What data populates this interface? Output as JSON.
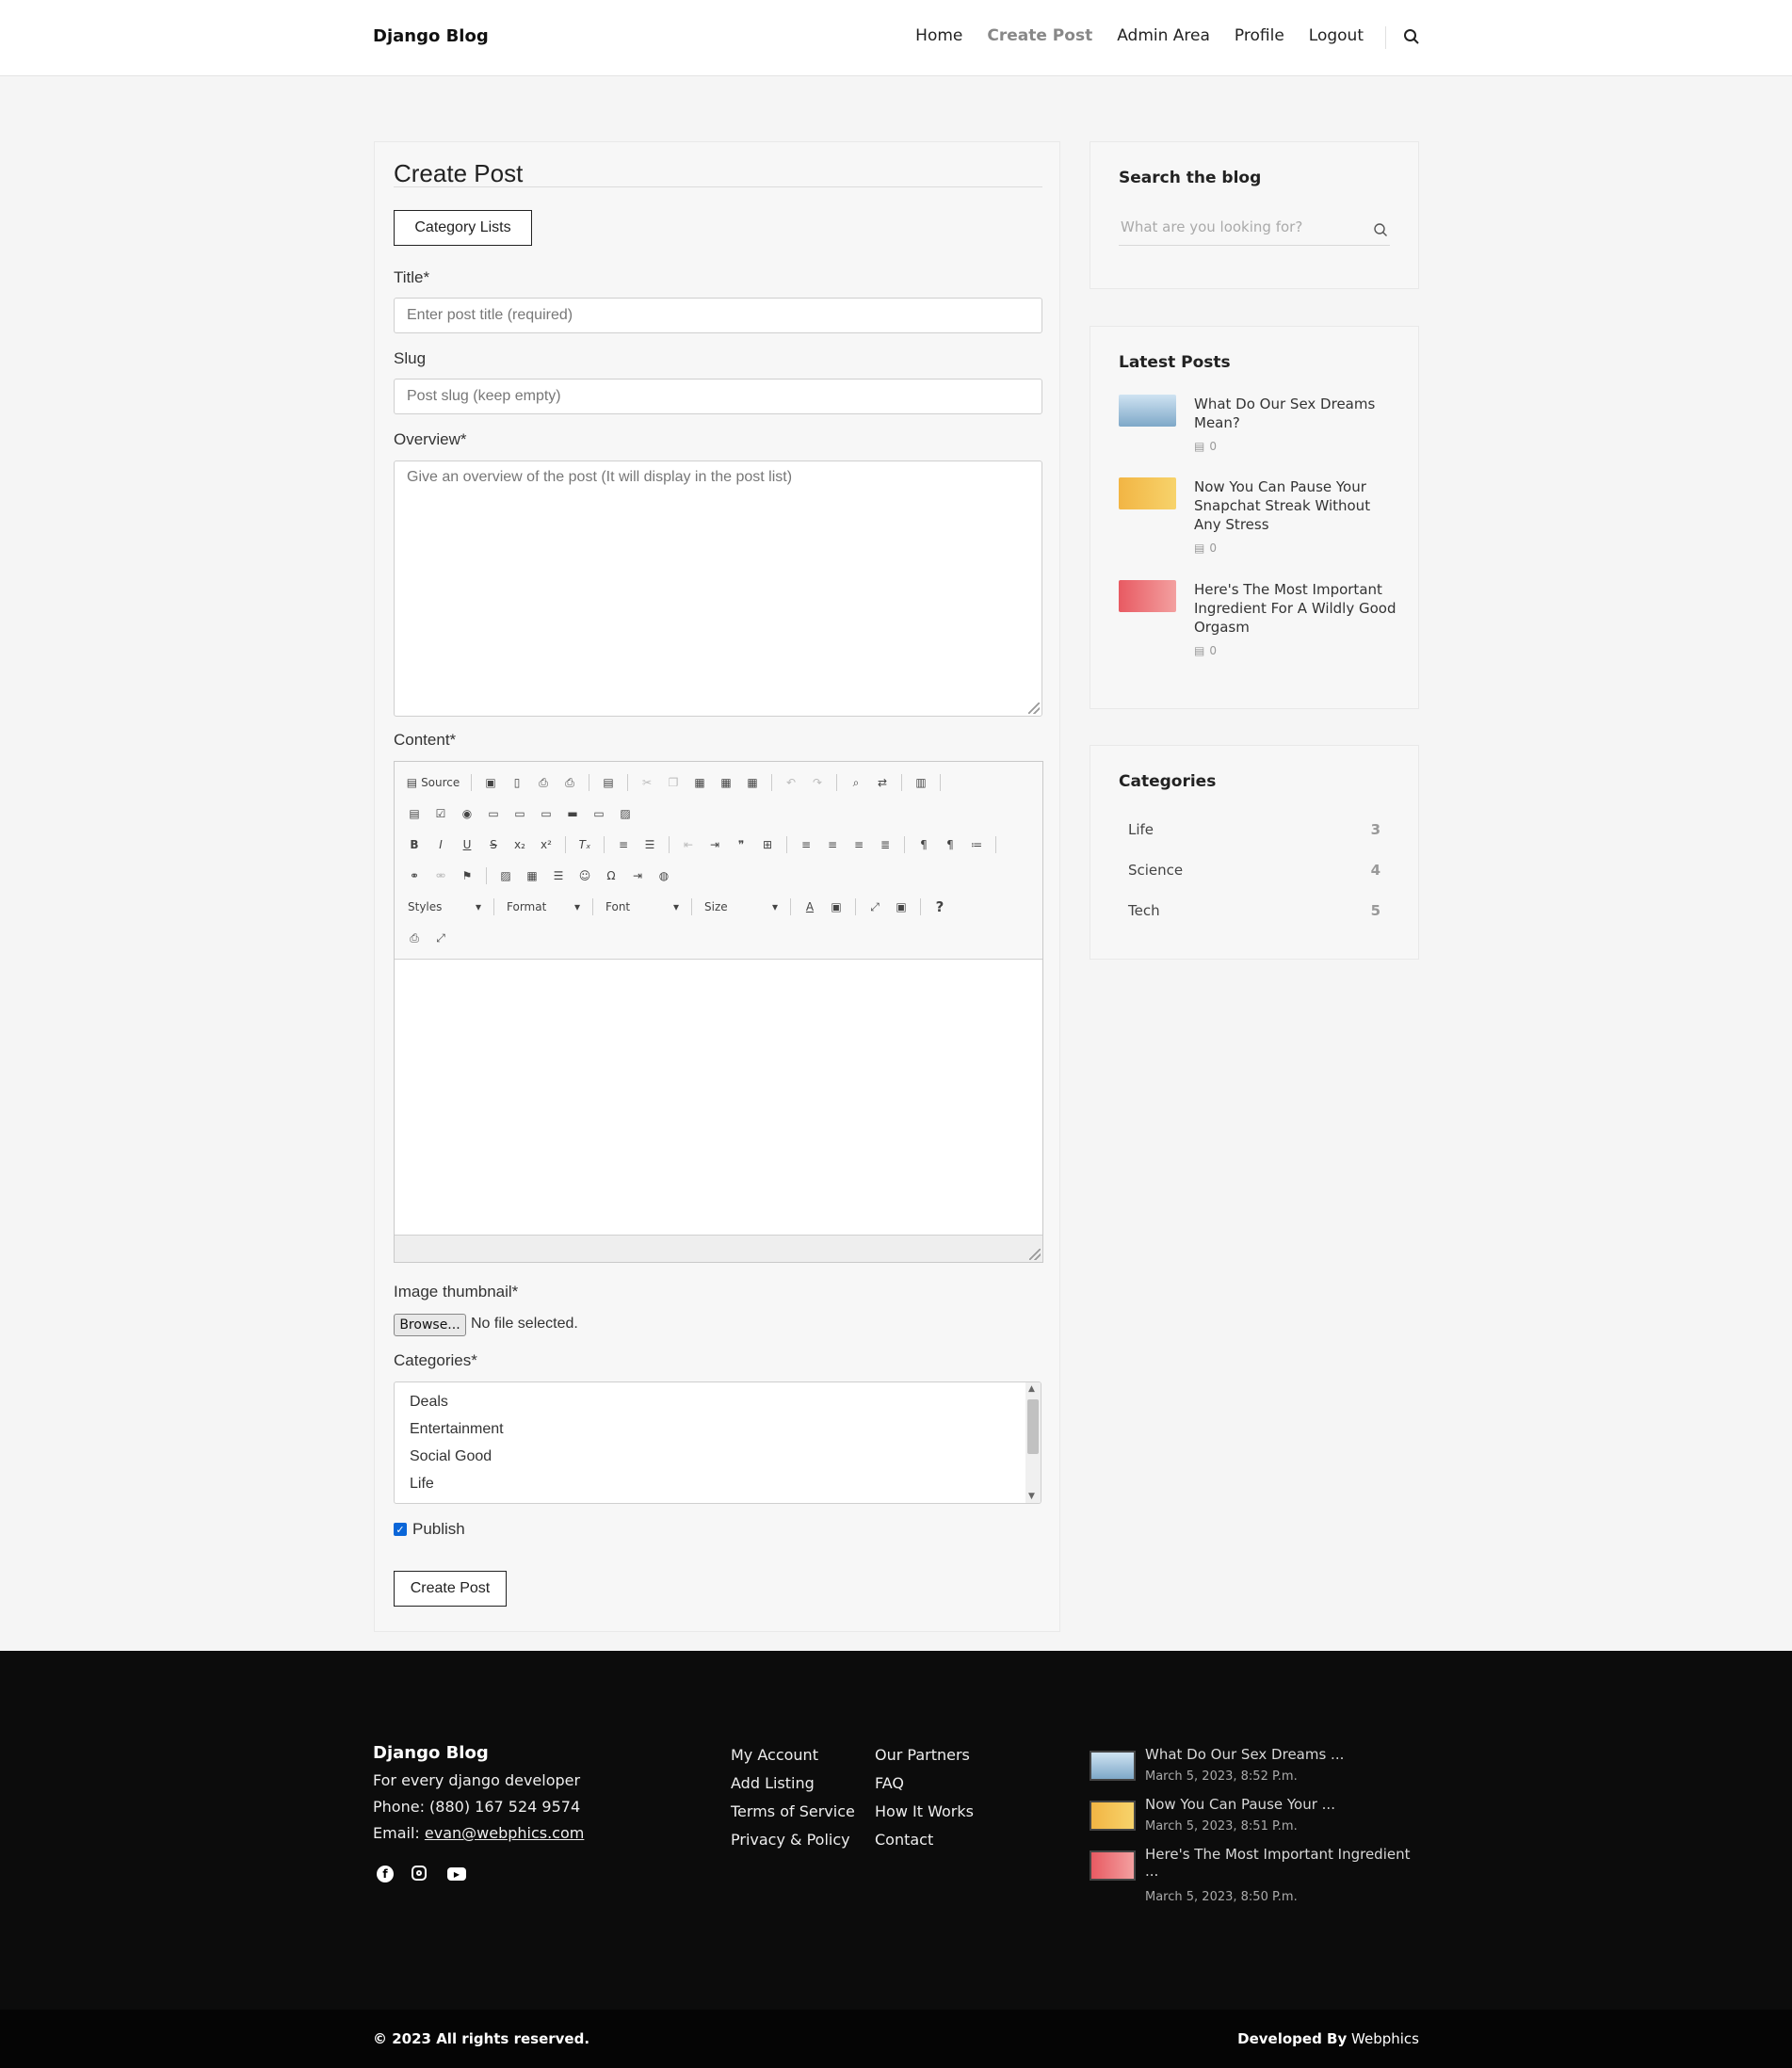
{
  "nav": {
    "brand": "Django Blog",
    "items": [
      "Home",
      "Create Post",
      "Admin Area",
      "Profile",
      "Logout"
    ],
    "search_icon": "search-icon"
  },
  "form": {
    "heading": "Create Post",
    "category_lists_label": "Category Lists",
    "title_label": "Title*",
    "title_placeholder": "Enter post title (required)",
    "slug_label": "Slug",
    "slug_placeholder": "Post slug (keep empty)",
    "overview_label": "Overview*",
    "overview_placeholder": "Give an overview of the post (It will display in the post list)",
    "content_label": "Content*",
    "editor": {
      "source_label": "Source",
      "styles_label": "Styles",
      "format_label": "Format",
      "font_label": "Font",
      "size_label": "Size"
    },
    "thumbnail_label": "Image thumbnail*",
    "browse_label": "Browse...",
    "no_file": "No file selected.",
    "categories_label": "Categories*",
    "category_options": [
      "Deals",
      "Entertainment",
      "Social Good",
      "Life"
    ],
    "publish_label": "Publish",
    "publish_checked": true,
    "submit_label": "Create Post"
  },
  "sidebar": {
    "search_title": "Search the blog",
    "search_placeholder": "What are you looking for?",
    "latest_title": "Latest Posts",
    "latest_posts": [
      {
        "title": "What Do Our Sex Dreams Mean?",
        "comments": "0"
      },
      {
        "title": "Now You Can Pause Your Snapchat Streak Without Any Stress",
        "comments": "0"
      },
      {
        "title": "Here's The Most Important Ingredient For A Wildly Good Orgasm",
        "comments": "0"
      }
    ],
    "categories_title": "Categories",
    "categories": [
      {
        "name": "Life",
        "count": "3"
      },
      {
        "name": "Science",
        "count": "4"
      },
      {
        "name": "Tech",
        "count": "5"
      }
    ]
  },
  "footer": {
    "brand": "Django Blog",
    "tagline": "For every django developer",
    "phone": "Phone: (880) 167 524 9574",
    "email_label": "Email:",
    "email": "evan@webphics.com",
    "social": [
      "facebook-icon",
      "instagram-icon",
      "youtube-icon"
    ],
    "links_col1": [
      "My Account",
      "Add Listing",
      "Terms of Service",
      "Privacy & Policy"
    ],
    "links_col2": [
      "Our Partners",
      "FAQ",
      "How It Works",
      "Contact"
    ],
    "recent": [
      {
        "title": "What Do Our Sex Dreams ...",
        "date": "March 5, 2023, 8:52 P.m."
      },
      {
        "title": "Now You Can Pause Your ...",
        "date": "March 5, 2023, 8:51 P.m."
      },
      {
        "title": "Here's The Most Important Ingredient ...",
        "date": "March 5, 2023, 8:50 P.m."
      }
    ],
    "copyright": "© 2023 All rights reserved.",
    "developed_by": "Developed By",
    "developer": "Webphics"
  },
  "colors": {
    "accent_check": "#0a66d8",
    "footer_bg": "#0c0c0c",
    "page_bg": "#f5f5f5"
  }
}
